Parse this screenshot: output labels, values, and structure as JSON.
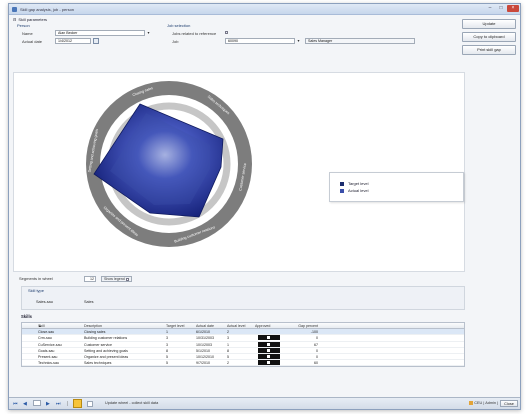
{
  "window": {
    "title": "Skill gap analysis, job - person"
  },
  "actions": {
    "update": "Update",
    "copy": "Copy to clipboard",
    "print": "Print skill gap"
  },
  "params": {
    "header": "Skill parameters",
    "person_title": "Person",
    "name_label": "Name",
    "name_value": "Alan Becker",
    "date_label": "Actual date",
    "date_value": "1/4/2012",
    "job_title": "Job selection",
    "jobs_related_label": "Jobs related to reference",
    "job_label": "Job",
    "job_value": "60090",
    "job_name": "Sales Manager"
  },
  "chart": {
    "segments": [
      {
        "label": "Closing sales"
      },
      {
        "label": "Sales techniques"
      },
      {
        "label": "Customer service"
      },
      {
        "label": "Building customer relations"
      },
      {
        "label": "Organize and present ideas"
      },
      {
        "label": "Setting and achieving goals"
      }
    ]
  },
  "legend": {
    "target": "Target level",
    "actual": "Actual level",
    "target_color": "#1b2c6e",
    "actual_color": "#3b4faa"
  },
  "controls": {
    "segments_label": "Segments in wheel",
    "segments_value": "12",
    "show_legend": "Show legend"
  },
  "skill_type": {
    "label": "Skill type",
    "code": "Sales-sau",
    "name": "Sales"
  },
  "skills": {
    "label": "Skills",
    "headers": {
      "skill": "Skill",
      "description": "Description",
      "target": "Target level",
      "actual_date": "Actual date",
      "actual_level": "Actual level",
      "approved": "Approved",
      "gap": "Gap percent"
    },
    "rows": [
      {
        "skill": "Close-sau",
        "description": "Closing sales",
        "target": "1",
        "actual_date": "6/1/2010",
        "actual_level": "2",
        "approved": false,
        "gap": "-100"
      },
      {
        "skill": "Crm-sau",
        "description": "Building customer relations",
        "target": "3",
        "actual_date": "10/31/2003",
        "actual_level": "3",
        "approved": true,
        "gap": "0"
      },
      {
        "skill": "CuService-sau",
        "description": "Customer service",
        "target": "3",
        "actual_date": "10/1/2003",
        "actual_level": "1",
        "approved": true,
        "gap": "67"
      },
      {
        "skill": "Goals-sau",
        "description": "Setting and achieving goals",
        "target": "8",
        "actual_date": "5/1/2010",
        "actual_level": "8",
        "approved": true,
        "gap": "0"
      },
      {
        "skill": "Present-sau",
        "description": "Organize and present ideas",
        "target": "5",
        "actual_date": "10/12/2010",
        "actual_level": "5",
        "approved": true,
        "gap": "0"
      },
      {
        "skill": "Technics-sau",
        "description": "Sales techniques",
        "target": "5",
        "actual_date": "9/7/2010",
        "actual_level": "2",
        "approved": true,
        "gap": "60"
      }
    ]
  },
  "status": {
    "message": "Update wheel - collect skill data",
    "company": "CEU",
    "user": "Admin",
    "close": "Close"
  }
}
